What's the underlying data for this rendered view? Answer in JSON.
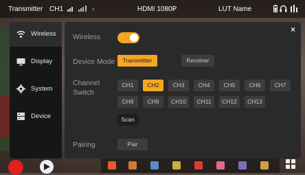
{
  "statusbar": {
    "mode": "Transmitter",
    "channel": "CH1",
    "video": "HDMI 1080P",
    "lut": "LUT Name"
  },
  "sidebar": {
    "items": [
      {
        "label": "Wireless",
        "icon": "wifi-icon",
        "active": true
      },
      {
        "label": "Display",
        "icon": "display-icon",
        "active": false
      },
      {
        "label": "System",
        "icon": "gear-icon",
        "active": false
      },
      {
        "label": "Device",
        "icon": "device-icon",
        "active": false
      }
    ]
  },
  "panel": {
    "wireless_label": "Wireless",
    "wireless_on": true,
    "device_mode_label": "Device Mode",
    "device_modes": [
      "Transmitter",
      "Receiver"
    ],
    "device_mode_selected": "Transmitter",
    "channel_switch_label": [
      "Channel",
      "Switch"
    ],
    "channels_row1": [
      "CH1",
      "CH2",
      "CH3",
      "CH4",
      "CH5",
      "CH6",
      "CH7"
    ],
    "channels_row2": [
      "CH8",
      "CH9",
      "CH10",
      "CH11",
      "CH12",
      "CH13"
    ],
    "channel_selected": "CH2",
    "scan_label": "Scan",
    "pairing_label": "Pairing",
    "pair_label": "Pair",
    "close_glyph": "×"
  },
  "colors": {
    "accent": "#f5a623",
    "panel": "#2a2a2a",
    "sidebar": "#161616",
    "record": "#e02020"
  }
}
